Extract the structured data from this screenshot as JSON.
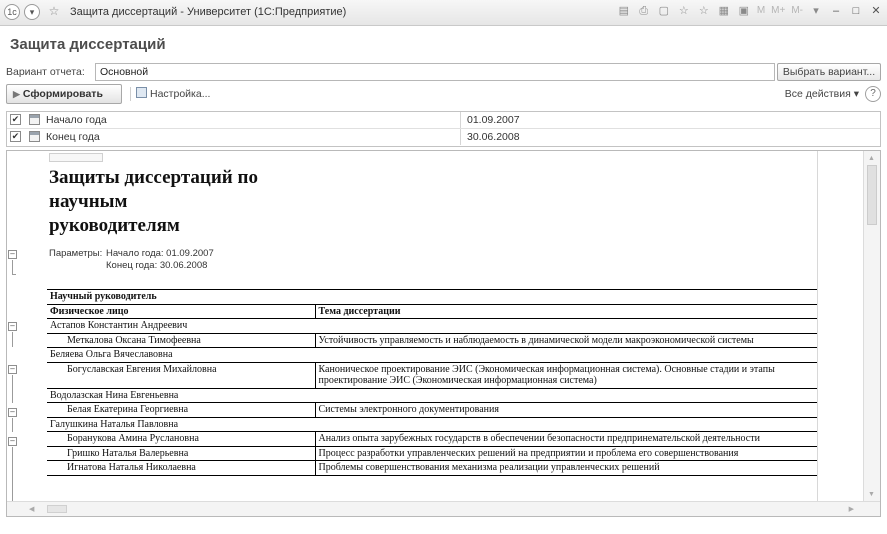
{
  "window": {
    "title": "Защита диссертаций - Университет (1С:Предприятие)",
    "toolbar_text_icons": [
      "M",
      "M+",
      "M-"
    ]
  },
  "page_title": "Защита диссертаций",
  "variant": {
    "label": "Вариант отчета:",
    "value": "Основной",
    "choose_button": "Выбрать вариант..."
  },
  "commands": {
    "generate": "Сформировать",
    "settings": "Настройка...",
    "all_actions": "Все действия ▾",
    "help": "?"
  },
  "params": [
    {
      "label": "Начало года",
      "value": "01.09.2007",
      "checked": true
    },
    {
      "label": "Конец года",
      "value": "30.06.2008",
      "checked": true
    }
  ],
  "report": {
    "title_lines": [
      "Защиты диссертаций по",
      "научным",
      "руководителям"
    ],
    "params_label": "Параметры:",
    "params_line1": "Начало года: 01.09.2007",
    "params_line2": "Конец года: 30.06.2008",
    "group_header": "Научный руководитель",
    "col_person": "Физическое лицо",
    "col_topic": "Тема диссертации",
    "groups": [
      {
        "supervisor": "Астапов Константин Андреевич",
        "rows": [
          {
            "person": "Меткалова Оксана Тимофеевна",
            "topic": "Устойчивость управляемость и наблюдаемость в динамической модели макроэкономической системы"
          }
        ]
      },
      {
        "supervisor": "Беляева Ольга Вячеславовна",
        "rows": [
          {
            "person": "Богуславская Евгения Михайловна",
            "topic": "Каноническое проектирование ЭИС (Экономическая информационная система). Основные стадии и этапы проектирование ЭИС (Экономическая информационная система)"
          }
        ]
      },
      {
        "supervisor": "Водолазская Нина Евгеньевна",
        "rows": [
          {
            "person": "Белая Екатерина Георгиевна",
            "topic": "Системы электронного документирования"
          }
        ]
      },
      {
        "supervisor": "Галушкина Наталья Павловна",
        "rows": [
          {
            "person": "Боранукова Амина Руслановна",
            "topic": "Анализ опыта зарубежных государств в обеспечении безопасности предпринемательской деятельности"
          },
          {
            "person": "Гришко Наталья Валерьевна",
            "topic": "Процесс разработки управленческих решений на предприятии и проблема его совершенствования"
          },
          {
            "person": "Игнатова Наталья Николаевна",
            "topic": "Проблемы совершенствования механизма реализации управленческих решений"
          }
        ]
      }
    ]
  }
}
